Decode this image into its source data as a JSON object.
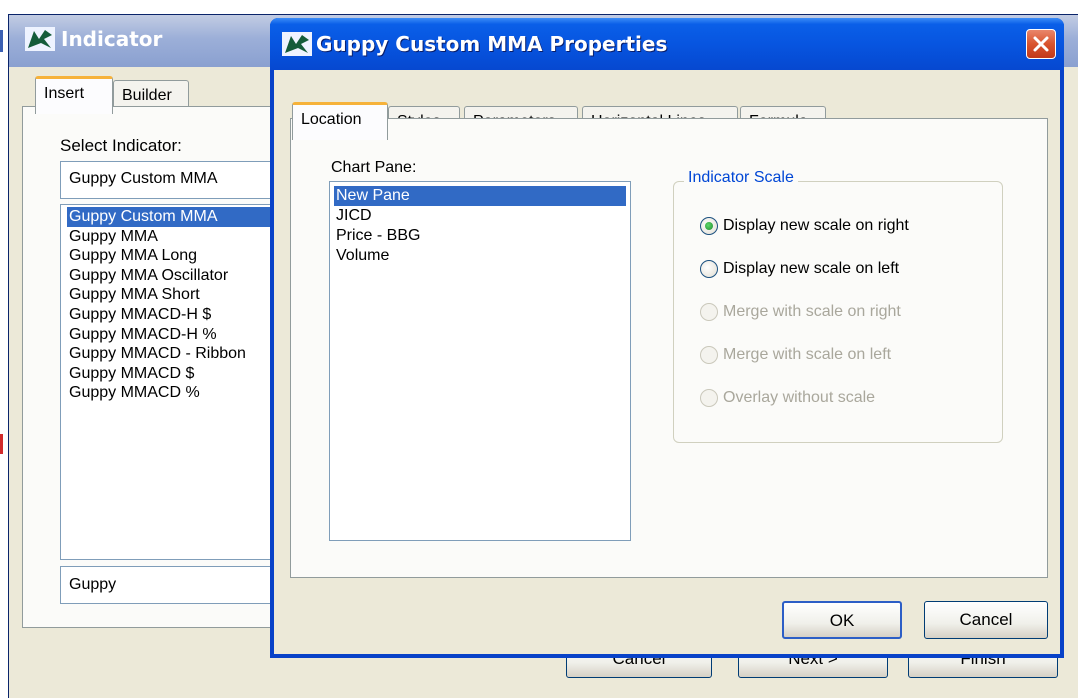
{
  "indicator_window": {
    "title": "Indicator",
    "tabs": [
      {
        "label": "Insert",
        "active": true
      },
      {
        "label": "Builder",
        "active": false
      }
    ],
    "select_label": "Select Indicator:",
    "selected_value": "Guppy Custom MMA",
    "list_items": [
      {
        "label": "Guppy Custom MMA",
        "selected": true
      },
      {
        "label": "Guppy MMA"
      },
      {
        "label": "Guppy MMA Long"
      },
      {
        "label": "Guppy MMA Oscillator"
      },
      {
        "label": "Guppy MMA Short"
      },
      {
        "label": "Guppy MMACD-H $"
      },
      {
        "label": "Guppy MMACD-H %"
      },
      {
        "label": "Guppy MMACD - Ribbon"
      },
      {
        "label": "Guppy MMACD $"
      },
      {
        "label": "Guppy MMACD %"
      }
    ],
    "search_value": "Guppy",
    "buttons": {
      "cancel": "Cancel",
      "next": "Next >",
      "finish": "Finish"
    }
  },
  "properties_dialog": {
    "title": "Guppy Custom MMA Properties",
    "tabs": [
      {
        "label": "Location",
        "active": true
      },
      {
        "label": "Styles"
      },
      {
        "label": "Parameters"
      },
      {
        "label": "Horizontal Lines"
      },
      {
        "label": "Formula"
      }
    ],
    "chart_pane_label": "Chart Pane:",
    "chart_panes": [
      {
        "label": "New Pane",
        "selected": true
      },
      {
        "label": "JICD"
      },
      {
        "label": "Price - BBG"
      },
      {
        "label": "Volume"
      }
    ],
    "scale_group": {
      "title": "Indicator Scale",
      "options": [
        {
          "label": "Display new scale on right",
          "checked": true,
          "enabled": true
        },
        {
          "label": "Display new scale on left",
          "checked": false,
          "enabled": true
        },
        {
          "label": "Merge with scale on right",
          "checked": false,
          "enabled": false
        },
        {
          "label": "Merge with scale on left",
          "checked": false,
          "enabled": false
        },
        {
          "label": "Overlay without scale",
          "checked": false,
          "enabled": false
        }
      ]
    },
    "buttons": {
      "ok": "OK",
      "cancel": "Cancel"
    }
  },
  "colors": {
    "title_active": "#0755e0",
    "title_inactive": "#9cafd8",
    "selection": "#316ac5",
    "group_title": "#0046d5",
    "close_button": "#d9542e",
    "tab_highlight": "#f6b23a"
  },
  "icons": [
    "app-logo-icon",
    "close-icon",
    "radio-icon"
  ]
}
